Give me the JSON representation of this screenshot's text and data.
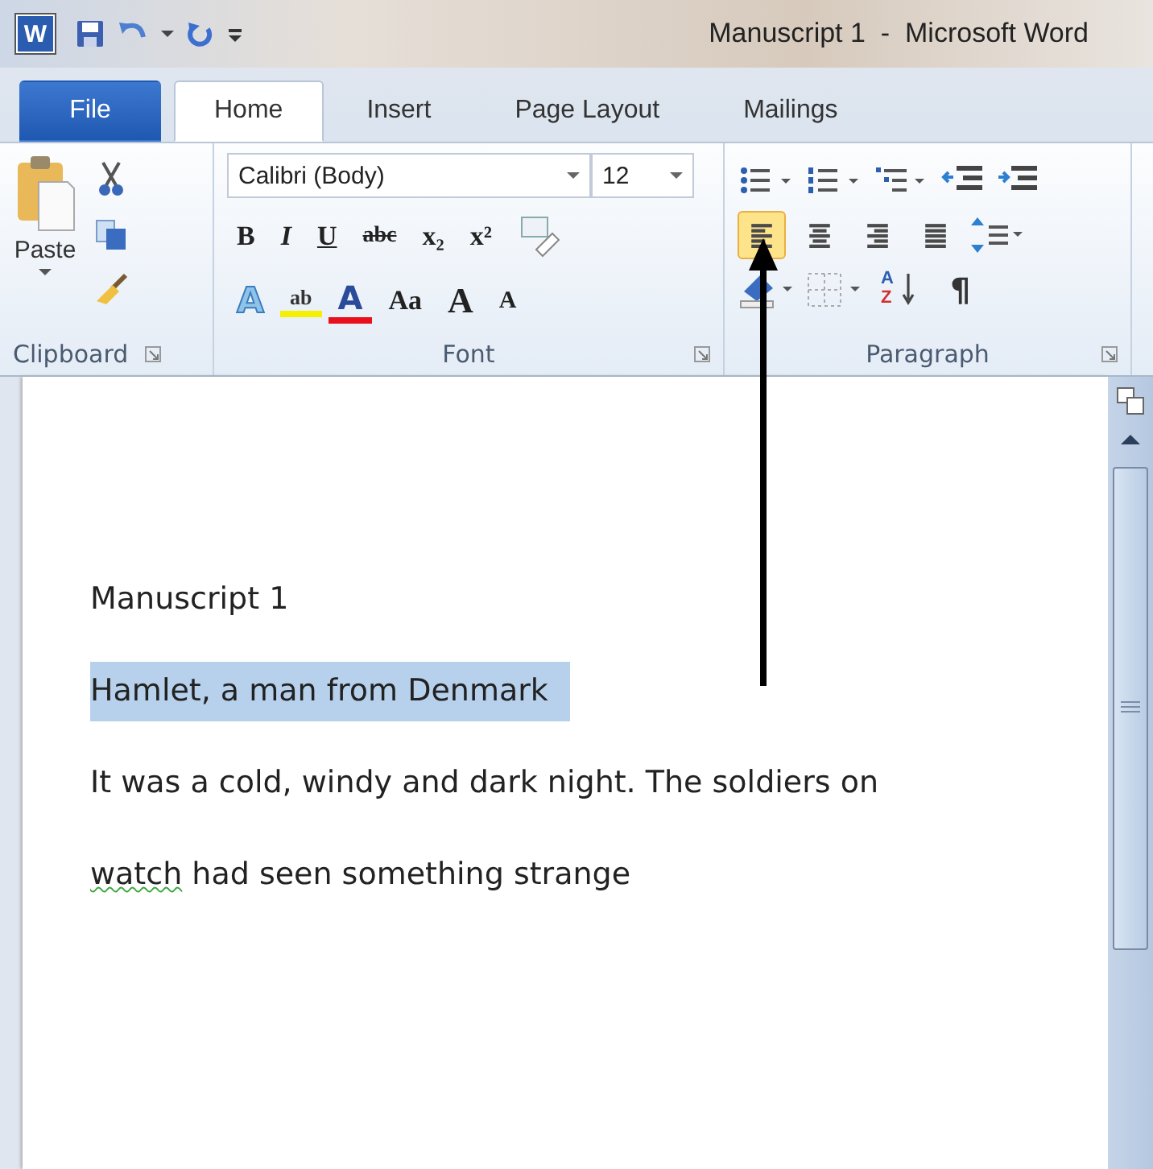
{
  "window": {
    "app_letter": "W",
    "title": "Manuscript 1  -  Microsoft Word"
  },
  "tabs": [
    {
      "label": "File",
      "kind": "file",
      "selected": false
    },
    {
      "label": "Home",
      "kind": "tab",
      "selected": true
    },
    {
      "label": "Insert",
      "kind": "tab",
      "selected": false
    },
    {
      "label": "Page Layout",
      "kind": "tab",
      "selected": false
    },
    {
      "label": "Mailings",
      "kind": "tab",
      "selected": false
    }
  ],
  "clipboard": {
    "paste": "Paste",
    "group": "Clipboard"
  },
  "font": {
    "family": "Calibri (Body)",
    "size": "12",
    "group": "Font",
    "row1": [
      {
        "label": "B",
        "kind": "bold"
      },
      {
        "label": "I",
        "kind": "italic"
      },
      {
        "label": "U",
        "kind": "underline"
      },
      {
        "label": "abc",
        "kind": "strike"
      },
      {
        "label": "x₂",
        "kind": "sub"
      },
      {
        "label": "x²",
        "kind": "sup"
      }
    ],
    "row2": [
      {
        "label": "A",
        "kind": "effects"
      },
      {
        "label": "ab",
        "kind": "highlight"
      },
      {
        "label": "A",
        "kind": "color"
      },
      {
        "label": "Aa",
        "kind": "case"
      },
      {
        "label": "A",
        "kind": "grow"
      },
      {
        "label": "A",
        "kind": "shrink"
      }
    ]
  },
  "paragraph": {
    "group": "Paragraph",
    "alignments": [
      {
        "kind": "left",
        "selected": true
      },
      {
        "kind": "center",
        "selected": false
      },
      {
        "kind": "right",
        "selected": false
      },
      {
        "kind": "justify",
        "selected": false
      }
    ],
    "sort": [
      "A",
      "Z"
    ],
    "marks": "¶"
  },
  "document": {
    "paragraphs": [
      {
        "selected": false,
        "segments": [
          {
            "text": "Manuscript 1",
            "flagged": false
          }
        ]
      },
      {
        "selected": true,
        "segments": [
          {
            "text": "Hamlet, a man from Denmark",
            "flagged": false
          }
        ]
      },
      {
        "selected": false,
        "segments": [
          {
            "text": "It was a cold, windy and dark night. The soldiers on",
            "flagged": false
          }
        ]
      },
      {
        "selected": false,
        "segments": [
          {
            "text": "watch",
            "flagged": true
          },
          {
            "text": " had seen something strange",
            "flagged": false
          }
        ]
      }
    ]
  }
}
